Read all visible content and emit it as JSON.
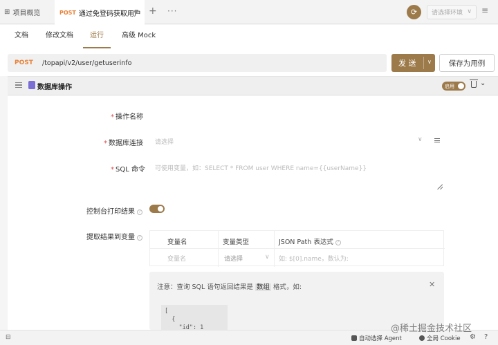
{
  "topbar": {
    "overview_tab": "项目概览",
    "active_tab": {
      "method": "POST",
      "title": "通过免登码获取用户"
    },
    "env_placeholder": "请选择环境"
  },
  "subtabs": [
    "文档",
    "修改文档",
    "运行",
    "高级 Mock"
  ],
  "active_subtab": "运行",
  "request": {
    "method": "POST",
    "path": "/topapi/v2/user/getuserinfo",
    "send_label": "发 送",
    "save_label": "保存为用例"
  },
  "db_operation": {
    "title": "数据库操作",
    "enable_label": "启用",
    "fields": {
      "operation_name_label": "操作名称",
      "db_connection_label": "数据库连接",
      "db_connection_placeholder": "请选择",
      "sql_label": "SQL 命令",
      "sql_placeholder": "可使用变量，如：SELECT * FROM user WHERE name={{userName}}",
      "console_print_label": "控制台打印结果",
      "extract_label": "提取结果到变量"
    },
    "variable_table": {
      "headers": [
        "变量名",
        "变量类型",
        "JSON Path 表达式"
      ],
      "row": {
        "name_placeholder": "变量名",
        "type_placeholder": "请选择",
        "path_placeholder": "如: $[0].name，数认为: $"
      }
    },
    "note": {
      "prefix": "注意：查询 SQL 语句返回结果是",
      "keyword": "数组",
      "suffix": "格式，如:",
      "code": "[\n  {\n    \"id\": 1"
    }
  },
  "statusbar": {
    "agent_label": "自动选择 Agent",
    "cookie_label": "全局 Cookie"
  },
  "watermark": "@稀土掘金技术社区",
  "colors": {
    "accent": "#9c7a4a",
    "method_post": "#e8833a",
    "required": "#e24c4c"
  }
}
